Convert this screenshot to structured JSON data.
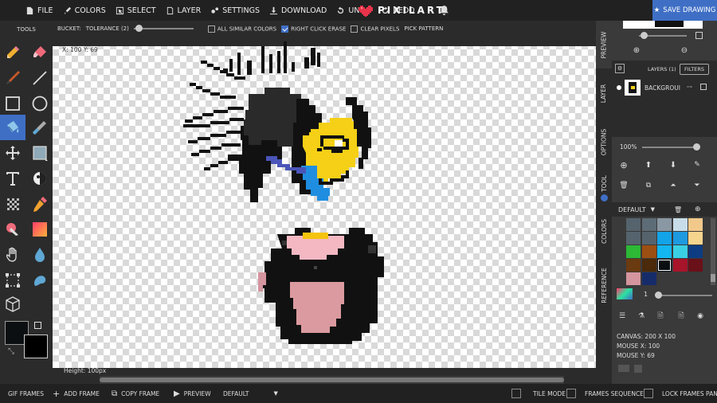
{
  "menu": {
    "file": "FILE",
    "colors": "COLORS",
    "select": "SELECT",
    "layer": "LAYER",
    "settings": "SETTINGS",
    "download": "DOWNLOAD",
    "undo": "UNDO",
    "redo": "REDO",
    "logo_text": "PIXILART",
    "save": "SAVE DRAWING"
  },
  "options_bar": {
    "bucket_label": "BUCKET:",
    "tolerance_label": "TOLERANCE (2)",
    "tolerance_value": 2,
    "all_similar_colors": "ALL SIMILAR COLORS",
    "all_similar_checked": false,
    "right_click_erase": "RIGHT CLICK ERASE",
    "right_click_erase_checked": true,
    "clear_pixels": "CLEAR PIXELS",
    "clear_pixels_checked": false,
    "pick_pattern": "PICK PATTERN"
  },
  "tools": {
    "title": "TOOLS",
    "items": [
      "pencil-icon",
      "eraser-icon",
      "line-brush-icon",
      "line-icon",
      "rectangle-icon",
      "circle-icon",
      "bucket-icon",
      "eyedropper-icon",
      "move-icon",
      "select-box-icon",
      "text-icon",
      "shading-icon",
      "dither-icon",
      "color-replace-icon",
      "color-eraser-icon",
      "gradient-icon",
      "hand-icon",
      "blur-icon",
      "crop-icon",
      "smudge-icon",
      "3d-cube-icon"
    ],
    "active": "bucket-icon",
    "primary_color": "#0b0f12",
    "secondary_color": "#000000"
  },
  "canvas": {
    "coords": "X: 100 Y: 69",
    "height_label": "Height: 100px"
  },
  "side_tabs": [
    "PREVIEW",
    "LAYER",
    "OPTIONS",
    "TOOL",
    "COLORS",
    "REFERENCE"
  ],
  "right_panel": {
    "layers_label": "LAYERS (1)",
    "filters": "FILTERS",
    "layer_name": "BACKGROUI",
    "zoom": "100%",
    "palette_name": "DEFAULT",
    "brush_size": "1",
    "canvas_info": "CANVAS: 200 X 100",
    "mouse_x": "MOUSE X: 100",
    "mouse_y": "MOUSE Y: 69"
  },
  "palette": {
    "colors": [
      "#55636d",
      "#5d6c76",
      "#8a98a3",
      "#c8dde9",
      "#f2c98b",
      "#55636d",
      "#55636d",
      "#13a3e8",
      "#1e9ae0",
      "#f5d48e",
      "#2db836",
      "#9c4f12",
      "#12b6f0",
      "#3ad0e4",
      "#0e3c82",
      "#6a3a10",
      "#4a2a0b",
      "#0b0f12",
      "#a8142a",
      "#6a1018",
      "#d4959e",
      "#162c6a",
      "#3a3a3a",
      "#3a3a3a",
      "#3a3a3a"
    ],
    "selected": 17
  },
  "bottom_bar": {
    "gif_frames": "GIF FRAMES",
    "add_frame": "ADD FRAME",
    "copy_frame": "COPY FRAME",
    "preview": "PREVIEW",
    "fps": "DEFAULT",
    "tile_mode": "TILE MODE",
    "frames_sequence": "FRAMES SEQUENCE",
    "lock_frames_panel": "LOCK FRAMES PANEL"
  }
}
